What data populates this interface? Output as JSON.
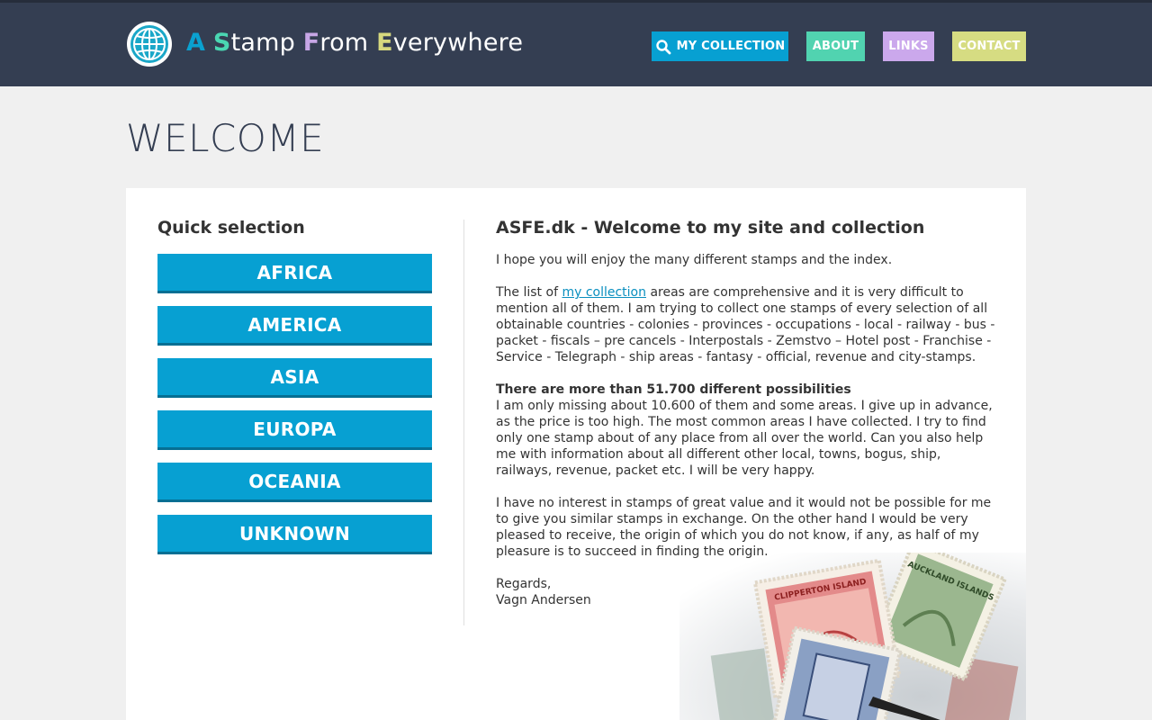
{
  "header": {
    "logo_parts": [
      {
        "text": "A",
        "cls": "c-blue"
      },
      {
        "text": " "
      },
      {
        "text": "S",
        "cls": "c-green"
      },
      {
        "text": "tamp "
      },
      {
        "text": "F",
        "cls": "c-purple"
      },
      {
        "text": "rom "
      },
      {
        "text": "E",
        "cls": "c-yellow"
      },
      {
        "text": "verywhere"
      }
    ],
    "nav": {
      "collection": "MY COLLECTION",
      "about": "ABOUT",
      "links": "LINKS",
      "contact": "CONTACT"
    },
    "colors": {
      "bar": "#343e52",
      "collection": "#07a0d2",
      "about": "#51d3b0",
      "links": "#cba8ec",
      "contact": "#d6dc82"
    }
  },
  "page_title": "WELCOME",
  "quick_selection": {
    "title": "Quick selection",
    "regions": [
      "AFRICA",
      "AMERICA",
      "ASIA",
      "EUROPA",
      "OCEANIA",
      "UNKNOWN"
    ]
  },
  "article": {
    "heading": "ASFE.dk - Welcome to my site and collection",
    "p1": "I hope you will enjoy the many different stamps and the index.",
    "p2_before": "The list of ",
    "p2_link": "my collection",
    "p2_after": " areas are comprehensive and it is very difficult to mention all of them. I am trying to collect one stamps of every selection of all obtainable countries - colonies - provinces - occupations - local - railway - bus - packet - fiscals – pre cancels - Interpostals - Zemstvo – Hotel post - Franchise - Service - Telegraph - ship areas - fantasy - official, revenue and city-stamps.",
    "p3_bold": "There are more than 51.700 different possibilities",
    "p3": "I am only missing about 10.600 of them and some areas. I give up in advance, as the price is too high. The most common areas I have collected. I try to find only one stamp about of any place from all over the world. Can you also help me with information about all different other local, towns, bogus, ship, railways, revenue, packet etc. I will be very happy.",
    "p4": "I have no interest in stamps of great value and it would not be possible for me to give you similar stamps in exchange. On the other hand I would be very pleased to receive, the origin of which you do not know, if any, as half of my pleasure is to succeed in finding the origin.",
    "regards": "Regards,",
    "signature": "Vagn Andersen"
  },
  "illustration": {
    "stamp1_text": "CLIPPERTON ISLAND",
    "stamp2_text": "AUCKLAND ISLANDS"
  }
}
